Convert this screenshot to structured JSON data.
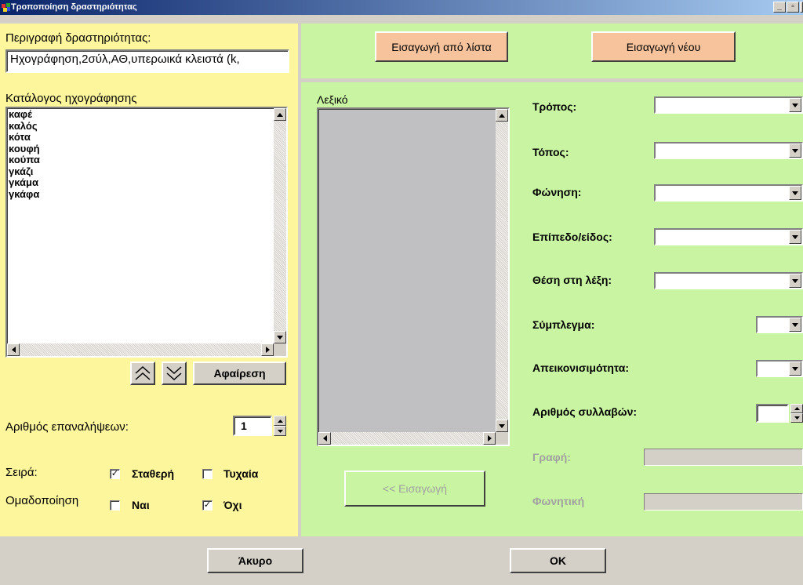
{
  "window": {
    "title": "Τροποποίηση δραστηριότητας",
    "min_label": "_",
    "max_label": "▫",
    "close_label": "✕"
  },
  "colors": {
    "left_panel": "#fdf69c",
    "right_panel": "#c9f5a3",
    "accent_button": "#f7c39c",
    "titlebar": "#0a246a"
  },
  "left": {
    "description_label": "Περιγραφή δραστηριότητας:",
    "description_value": "Ηχογράφηση,2σύλ,ΑΘ,υπερωικά κλειστά (k,",
    "catalog_label": "Κατάλογος ηχογράφησης",
    "catalog_items": [
      "καφέ",
      "καλός",
      "κότα",
      "κουφή",
      "κούπα",
      "γκάζι",
      "γκάμα",
      "γκάφα"
    ],
    "remove_button": "Αφαίρεση",
    "repetitions_label": "Αριθμός επαναλήψεων:",
    "repetitions_value": "1",
    "order_label": "Σειρά:",
    "order_fixed": "Σταθερή",
    "order_fixed_checked": true,
    "order_random": "Τυχαία",
    "order_random_checked": false,
    "grouping_label": "Ομαδοποίηση",
    "grouping_yes": "Ναι",
    "grouping_yes_checked": false,
    "grouping_no": "Όχι",
    "grouping_no_checked": true
  },
  "top": {
    "import_list_button": "Εισαγωγή από λίστα",
    "import_new_button": "Εισαγωγή νέου"
  },
  "right": {
    "dictionary_label": "Λεξικό",
    "insert_button": "<< Εισαγωγή",
    "fields": {
      "manner": "Τρόπος:",
      "place": "Τόπος:",
      "voicing": "Φώνηση:",
      "level": "Επίπεδο/είδος:",
      "position": "Θέση στη λέξη:",
      "cluster": "Σύμπλεγμα:",
      "imageability": "Απεικονισιμότητα:",
      "syllables": "Αριθμός συλλαβών:",
      "spelling": "Γραφή:",
      "phonetic": "Φωνητική"
    }
  },
  "bottom": {
    "cancel_button": "Άκυρο",
    "ok_button": "OK"
  }
}
